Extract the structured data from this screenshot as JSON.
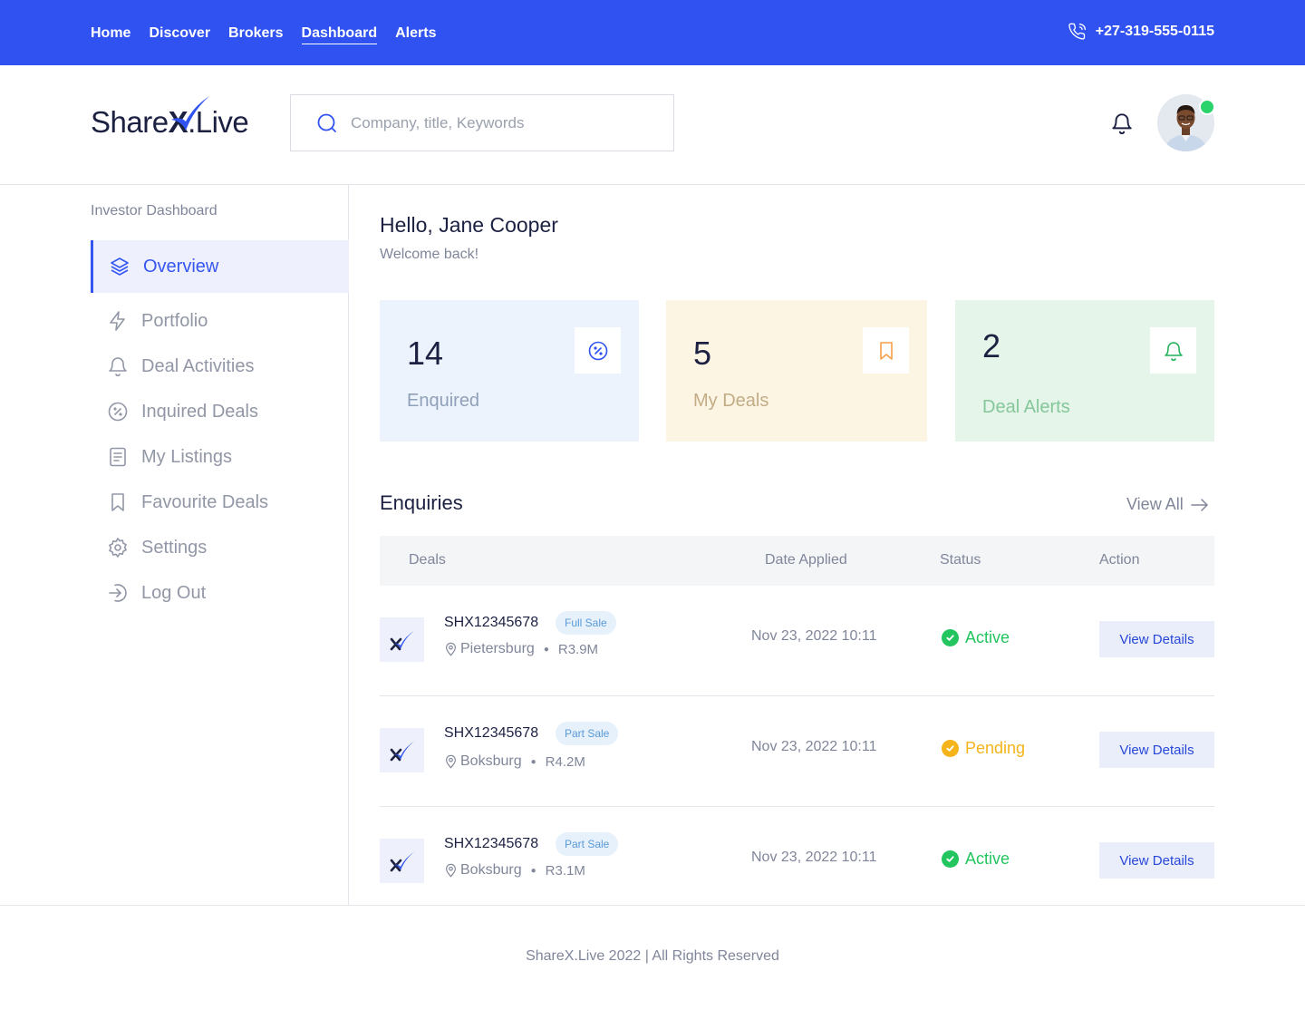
{
  "topnav": {
    "items": [
      "Home",
      "Discover",
      "Brokers",
      "Dashboard",
      "Alerts"
    ],
    "active": "Dashboard",
    "phone": "+27-319-555-0115"
  },
  "header": {
    "logo_main": "Share",
    "logo_x": "X",
    "logo_suffix": ".Live",
    "search_placeholder": "Company, title, Keywords"
  },
  "sidebar": {
    "title": "Investor Dashboard",
    "items": [
      {
        "label": "Overview",
        "icon": "layers-icon",
        "active": true
      },
      {
        "label": "Portfolio",
        "icon": "lightning-icon"
      },
      {
        "label": "Deal Activities",
        "icon": "bell-icon"
      },
      {
        "label": "Inquired Deals",
        "icon": "percent-icon"
      },
      {
        "label": "My Listings",
        "icon": "document-icon"
      },
      {
        "label": "Favourite Deals",
        "icon": "bookmark-icon"
      },
      {
        "label": "Settings",
        "icon": "gear-icon"
      },
      {
        "label": "Log Out",
        "icon": "logout-icon"
      }
    ]
  },
  "main": {
    "greeting": "Hello, Jane Cooper",
    "welcome": "Welcome back!",
    "cards": [
      {
        "value": "14",
        "label": "Enquired",
        "icon": "percent-icon",
        "accent": "#2f52f0"
      },
      {
        "value": "5",
        "label": "My Deals",
        "icon": "bookmark-icon",
        "accent": "#f5a04a"
      },
      {
        "value": "2",
        "label": "Deal Alerts",
        "icon": "bell-icon",
        "accent": "#22b25a"
      }
    ],
    "enquiries": {
      "title": "Enquiries",
      "view_all": "View All",
      "columns": [
        "Deals",
        "Date Applied",
        "Status",
        "Action"
      ],
      "rows": [
        {
          "code": "SHX12345678",
          "tag": "Full Sale",
          "location": "Pietersburg",
          "price": "R3.9M",
          "date": "Nov 23, 2022 10:11",
          "status": "Active",
          "status_color": "#22c55e",
          "action": "View Details"
        },
        {
          "code": "SHX12345678",
          "tag": "Part Sale",
          "location": "Boksburg",
          "price": "R4.2M",
          "date": "Nov 23, 2022 10:11",
          "status": "Pending",
          "status_color": "#f4b41a",
          "action": "View Details"
        },
        {
          "code": "SHX12345678",
          "tag": "Part Sale",
          "location": "Boksburg",
          "price": "R3.1M",
          "date": "Nov 23, 2022 10:11",
          "status": "Active",
          "status_color": "#22c55e",
          "action": "View Details"
        }
      ]
    }
  },
  "footer": {
    "text": "ShareX.Live 2022 | All Rights Reserved"
  },
  "colors": {
    "brand": "#2f52f0",
    "active_nav": "#3556ee"
  }
}
